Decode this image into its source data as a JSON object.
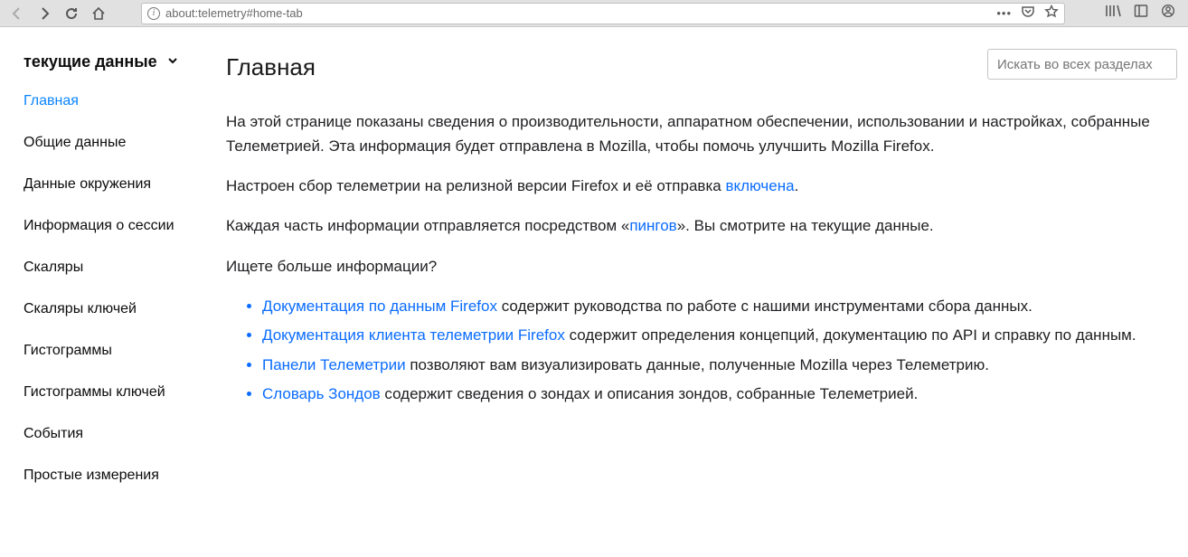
{
  "toolbar": {
    "url": "about:telemetry#home-tab"
  },
  "sidebar": {
    "header": "текущие данные",
    "items": [
      "Главная",
      "Общие данные",
      "Данные окружения",
      "Информация о сессии",
      "Скаляры",
      "Скаляры ключей",
      "Гистограммы",
      "Гистограммы ключей",
      "События",
      "Простые измерения"
    ]
  },
  "search": {
    "placeholder": "Искать во всех разделах"
  },
  "main": {
    "title": "Главная",
    "p1": "На этой странице показаны сведения о производительности, аппаратном обеспечении, использовании и настройках, собранные Телеметрией. Эта информация будет отправлена в Mozilla, чтобы помочь улучшить Mozilla Firefox.",
    "p2a": "Настроен сбор телеметрии на релизной версии Firefox и её отправка ",
    "p2link": "включена",
    "p2b": ".",
    "p3a": "Каждая часть информации отправляется посредством «",
    "p3link": "пингов",
    "p3b": "». Вы смотрите на текущие данные.",
    "p4": "Ищете больше информации?",
    "bullets": [
      {
        "link": "Документация по данным Firefox",
        "rest": " содержит руководства по работе с нашими инструментами сбора данных."
      },
      {
        "link": "Документация клиента телеметрии Firefox",
        "rest": " содержит определения концепций, документацию по API и справку по данным."
      },
      {
        "link": "Панели Телеметрии",
        "rest": " позволяют вам визуализировать данные, полученные Mozilla через Телеметрию."
      },
      {
        "link": "Словарь Зондов",
        "rest": " содержит сведения о зондах и описания зондов, собранные Телеметрией."
      }
    ]
  }
}
